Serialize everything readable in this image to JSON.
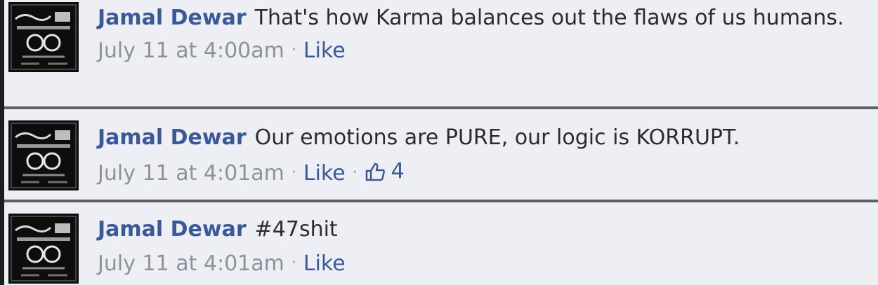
{
  "comments": [
    {
      "author": "Jamal Dewar",
      "text": "That's how Karma balances out the flaws of us humans.",
      "timestamp": "July 11 at 4:00am",
      "like_label": "Like",
      "like_count": null
    },
    {
      "author": "Jamal Dewar",
      "text": "Our emotions are PURE, our logic is KORRUPT.",
      "timestamp": "July 11 at 4:01am",
      "like_label": "Like",
      "like_count": "4"
    },
    {
      "author": "Jamal Dewar",
      "text": "#47shit",
      "timestamp": "July 11 at 4:01am",
      "like_label": "Like",
      "like_count": null
    }
  ],
  "separator": "·",
  "icons": {
    "like_count_icon": "thumbs-up-icon"
  },
  "colors": {
    "link": "#3b5998",
    "comment_background": "#edeff4",
    "meta_text": "#8d929b",
    "body_text": "#2a2c31"
  }
}
